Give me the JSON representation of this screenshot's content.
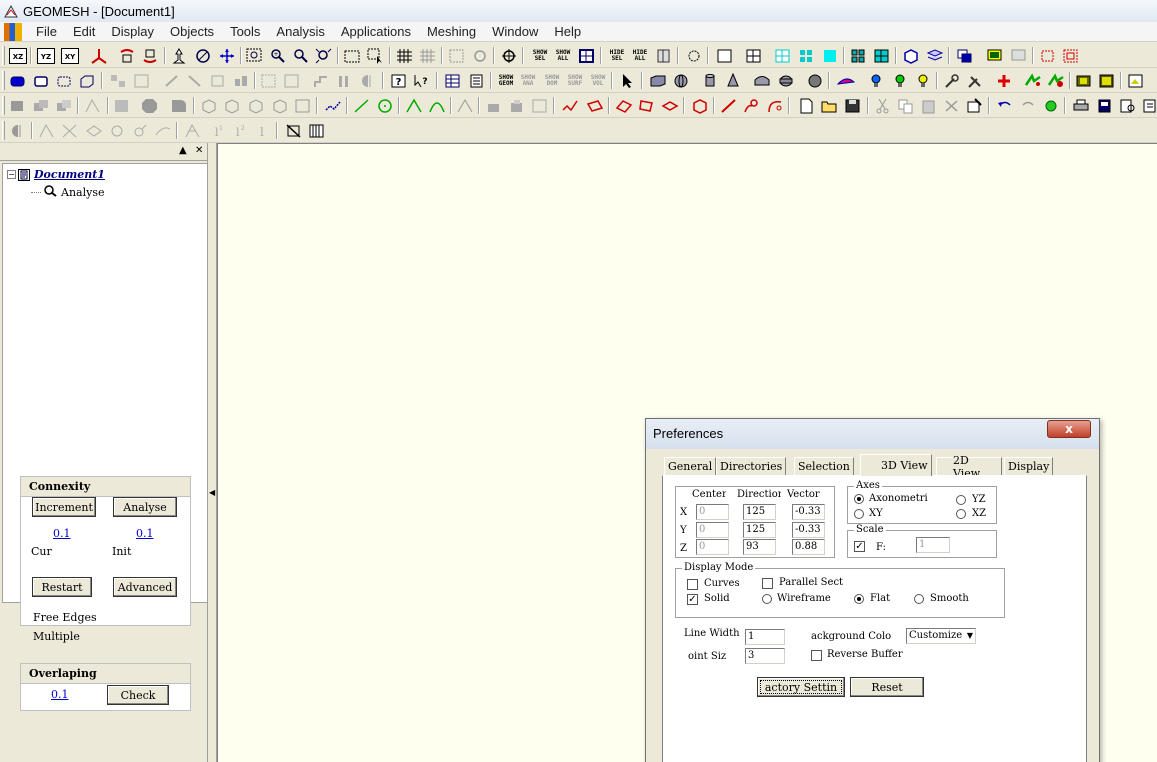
{
  "window": {
    "title": "GEOMESH - [Document1]"
  },
  "menu": [
    "File",
    "Edit",
    "Display",
    "Objects",
    "Tools",
    "Analysis",
    "Applications",
    "Meshing",
    "Window",
    "Help"
  ],
  "toolbar1": {
    "xz": "XZ",
    "yz": "YZ",
    "xy": "XY",
    "show_sel": [
      "SHOW",
      "SEL"
    ],
    "show_all": [
      "SHOW",
      "ALL"
    ],
    "hide_sel": [
      "HIDE",
      "SEL"
    ],
    "hide_all": [
      "HIDE",
      "ALL"
    ]
  },
  "toolbar2": {
    "show_geom": [
      "SHOW",
      "GEOM"
    ],
    "show_ana": [
      "SHOW",
      "ANA"
    ],
    "show_dom": [
      "SHOW",
      "DOM"
    ],
    "show_surf": [
      "SHOW",
      "SURF"
    ],
    "show_vol": [
      "SHOW",
      "VOL"
    ]
  },
  "tree": {
    "document": "Document1",
    "analyse": "Analyse"
  },
  "connexity": {
    "title": "Connexity",
    "increment": "Increment",
    "analyse": "Analyse",
    "cur_value": "0.1",
    "init_value": "0.1",
    "cur_label": "Cur",
    "init_label": "Init",
    "restart": "Restart",
    "advanced": "Advanced",
    "free_edges": "Free Edges",
    "multiple": "Multiple"
  },
  "overlaping": {
    "title": "Overlaping",
    "value": "0.1",
    "check": "Check"
  },
  "preferences": {
    "title": "Preferences",
    "close": "x",
    "tabs": [
      "General",
      "Directories",
      "Selection",
      "3D View",
      "2D View",
      "Display"
    ],
    "active_tab": "3D View",
    "columns": [
      "Center",
      "Direction",
      "Vector"
    ],
    "rows": [
      {
        "axis": "X",
        "center": "0",
        "direction": "125",
        "vector": "-0.33"
      },
      {
        "axis": "Y",
        "center": "0",
        "direction": "125",
        "vector": "-0.33"
      },
      {
        "axis": "Z",
        "center": "0",
        "direction": "93",
        "vector": "0.88"
      }
    ],
    "axes": {
      "title": "Axes",
      "axonometric": "Axonometri",
      "xy": "XY",
      "yz": "YZ",
      "xz": "XZ",
      "selected": "Axonometric"
    },
    "scale": {
      "title": "Scale",
      "f_label": "F:",
      "f_value": "1",
      "checked": true
    },
    "display_mode": {
      "title": "Display Mode",
      "curves": "Curves",
      "parallel_sect": "Parallel Sect",
      "solid": "Solid",
      "wireframe": "Wireframe",
      "flat": "Flat",
      "smooth": "Smooth",
      "solid_checked": true,
      "selected_shading": "Flat"
    },
    "line_width_label": "Line Width",
    "line_width": "1",
    "point_size_label": "oint Siz",
    "point_size": "3",
    "bg_color_label": "ackground Colo",
    "bg_color_value": "Customize",
    "reverse_buffer": "Reverse Buffer",
    "factory_settings": "actory Settin",
    "reset": "Reset"
  }
}
